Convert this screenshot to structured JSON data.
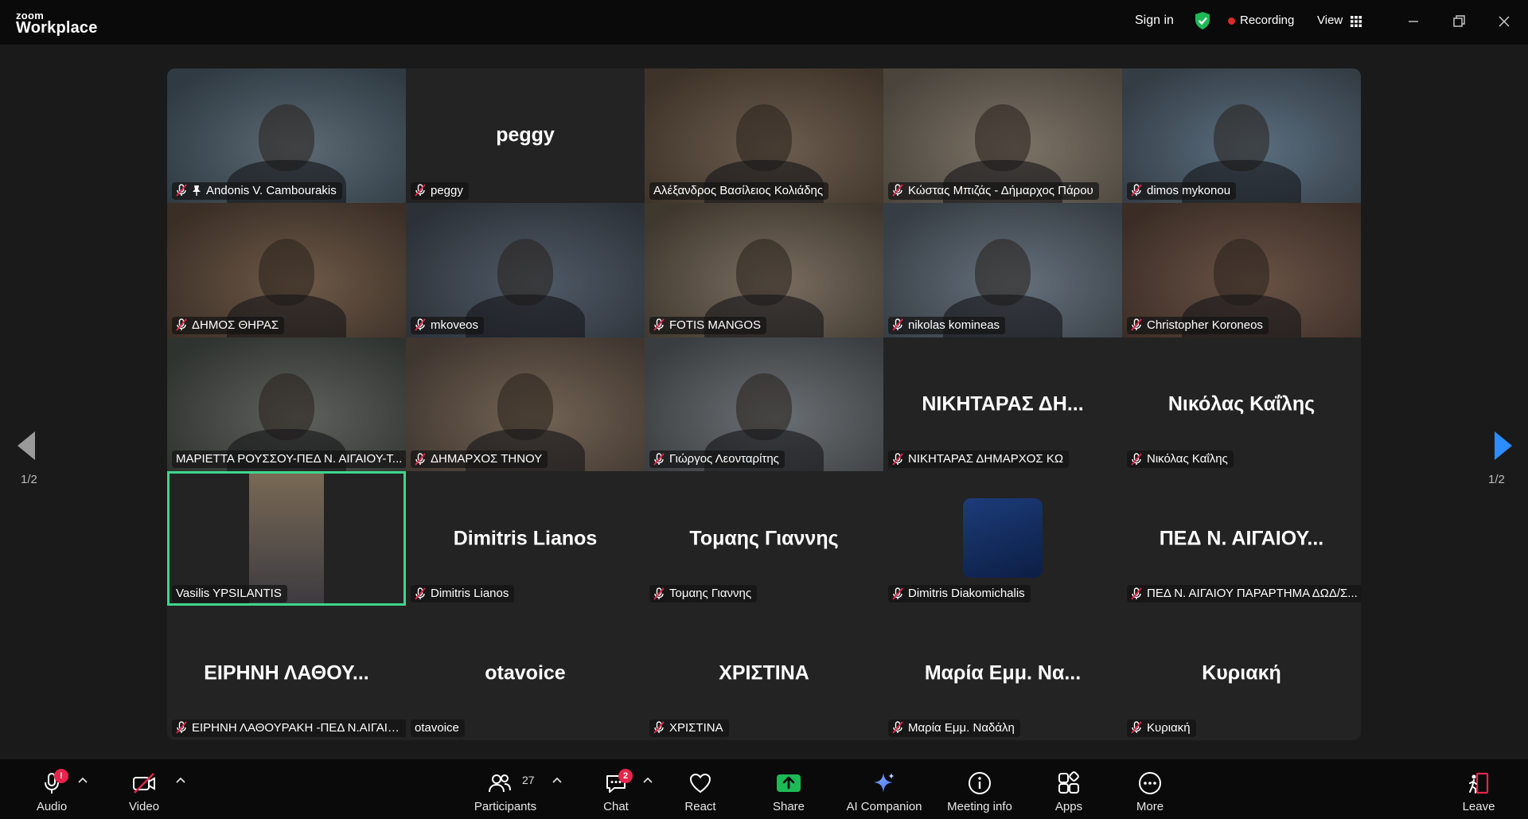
{
  "app": {
    "logo_small": "zoom",
    "logo_big": "Workplace"
  },
  "topbar": {
    "sign_in": "Sign in",
    "recording": "Recording",
    "view": "View"
  },
  "pagination": {
    "left": "1/2",
    "right": "1/2"
  },
  "tiles": [
    {
      "label": "Andonis V. Cambourakis",
      "video": true,
      "pinned": true,
      "muted": true
    },
    {
      "label": "peggy",
      "big": "peggy",
      "muted": true
    },
    {
      "label": "Αλέξανδρος Βασίλειος Κολιάδης",
      "video": true,
      "muted": false
    },
    {
      "label": "Κώστας Μπιζάς - Δήμαρχος Πάρου",
      "video": true,
      "muted": true
    },
    {
      "label": "dimos mykonou",
      "video": true,
      "muted": true
    },
    {
      "label": "ΔΗΜΟΣ ΘΗΡΑΣ",
      "video": true,
      "muted": true
    },
    {
      "label": "mkoveos",
      "video": true,
      "muted": true
    },
    {
      "label": "FOTIS MANGOS",
      "video": true,
      "muted": true
    },
    {
      "label": "nikolas komineas",
      "video": true,
      "muted": true
    },
    {
      "label": "Christopher Koroneos",
      "video": true,
      "muted": true
    },
    {
      "label": "ΜΑΡΙΕΤΤΑ ΡΟΥΣΣΟΥ-ΠΕΔ Ν. ΑΙΓΑΙΟΥ-Τ...",
      "video": true,
      "muted": false
    },
    {
      "label": "ΔΗΜΑΡΧΟΣ ΤΗΝΟΥ",
      "video": true,
      "muted": true
    },
    {
      "label": "Γιώργος Λεονταρίτης",
      "video": true,
      "muted": true
    },
    {
      "label": "ΝΙΚΗΤΑΡΑΣ ΔΗΜΑΡΧΟΣ ΚΩ",
      "big": "ΝΙΚΗΤΑΡΑΣ ΔΗ...",
      "muted": true
    },
    {
      "label": "Νικόλας Καΐλης",
      "big": "Νικόλας Καΐλης",
      "muted": true
    },
    {
      "label": "Vasilis YPSILANTIS",
      "portrait": true,
      "active": true,
      "muted": false
    },
    {
      "label": "Dimitris Lianos",
      "big": "Dimitris Lianos",
      "muted": true
    },
    {
      "label": "Τομαης Γιαννης",
      "big": "Τομαης Γιαννης",
      "muted": true
    },
    {
      "label": "Dimitris Diakomichalis",
      "avatar": true,
      "muted": true
    },
    {
      "label": "ΠΕΔ Ν. ΑΙΓΑΙΟΥ ΠΑΡΑΡΤΗΜΑ ΔΩΔ/Σ...",
      "big": "ΠΕΔ Ν. ΑΙΓΑΙΟΥ...",
      "muted": true
    },
    {
      "label": "ΕΙΡΗΝΗ ΛΑΘΟΥΡΑΚΗ -ΠΕΔ Ν.ΑΙΓΑΙΟ...",
      "big": "ΕΙΡΗΝΗ  ΛΑΘΟΥ...",
      "muted": true
    },
    {
      "label": "otavoice",
      "big": "otavoice",
      "muted": false
    },
    {
      "label": "ΧΡΙΣΤΙΝΑ",
      "big": "ΧΡΙΣΤΙΝΑ",
      "muted": true
    },
    {
      "label": "Μαρία Εμμ. Ναδάλη",
      "big": "Μαρία Εμμ. Να...",
      "muted": true
    },
    {
      "label": "Κυριακή",
      "big": "Κυριακή",
      "muted": true
    }
  ],
  "toolbar": {
    "audio": "Audio",
    "audio_badge": "!",
    "video": "Video",
    "participants": "Participants",
    "participants_count": "27",
    "chat": "Chat",
    "chat_badge": "2",
    "react": "React",
    "share": "Share",
    "ai_companion": "AI Companion",
    "meeting_info": "Meeting info",
    "apps": "Apps",
    "more": "More",
    "leave": "Leave"
  },
  "colors": {
    "active_border": "#3dd68c",
    "share_green": "#1db954",
    "recording_red": "#e02828",
    "badge_red": "#e5254b",
    "nav_blue": "#2d8cff"
  }
}
